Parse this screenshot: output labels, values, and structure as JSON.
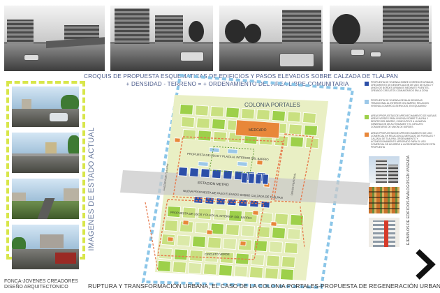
{
  "title": {
    "line1": "CROQUIS DE PROPUESTA ESQUEMATICAS DE EDIFICIOS Y PASOS ELEVADOS SOBRE CALZADA DE TLALPAN",
    "line2": "+ DENSIDAD - TERRENO = + ORDENAMIENTO DEL AREA LIBRE COMUNITARIA"
  },
  "left_panel": {
    "label": "IMAGENES DE ESTADO ACTUAL",
    "credits_line1": "FONCA-JOVENES CREADORES",
    "credits_line2": "DISEÑO ARQUITECTONICO"
  },
  "map": {
    "labels": {
      "colonia": "COLONIA PORTALES",
      "mercado": "MERCADO",
      "estacion": "ESTACION METRO",
      "propuesta_usos_top": "PROPUESTA DE USOS Y PLAZA AL INTERIOR DEL BARRIO",
      "nueva_propuesta": "NUEVA PROPUESTA DE PASO ELEVADO SOBRE CALZADA DE TLALPAN",
      "propuesta_usos_bottom": "PROPUESTA DE USOS Y PLAZA AL INTERIOR DEL BARRIO",
      "circuito": "CIRCUITO VERDE",
      "calzada": "CALZADA DE TLALPAN",
      "cruce": "CRUCE PEATONAL"
    }
  },
  "legend": [
    {
      "color": "#2c4fa8",
      "text": "PROPUESTA DE VIVIENDA SOBRE CORREDOR URBANO, CRECIMIENTO DE DENSIFICACION DE USO DE SUELO Y UNION DE BORDES URBANOS MEDIANTE PUENTES, CREANDO CIRCUITOS COMUNITARIOS EN LA ZONA"
    },
    {
      "color": "#9cc8e8",
      "text": "PROPUESTA DE VIVIENDA DE BAJA DENSIDAD TRADICIONAL AL INTERIOR DEL BARRIO, RELACION VIVIENDA COMERCIO-SERVICIOS, EN EQUILIBRIO"
    },
    {
      "color": "#9dd04a",
      "text": "AREAS PROPUESTAS DE APROVECHAMIENTO DE NUEVAS AREAS VERDES PARA VIVIENDA SOBRE TLALPAN Y DENTRO DEL BARRIO, COMO APOYO A LA NUEVA GENERACION DE ACTIVIDADES Y EL CIRCUITO COMUNITARIO DE UNION DE BORDES"
    },
    {
      "color": "#e8873a",
      "text": "AREAS PROPUESTAS DE APROVECHAMIENTO DE USO COMERCIAL EN RELACION AL MERCADO DE PORTALES Y CALZADA DE TLALPAN, ORDENAMIENTO Y ACONDICIONAMIENTO APROPIADO PARA EL USO COMERCIAL DE ACUERDO A LA REGENERACION DE ESTA PROPUESTA"
    }
  ],
  "right_panel": {
    "label": "EJEMPLOS DE EDIFICIOS ANALOGOS EN VIVIENDA"
  },
  "footer": {
    "title": "RUPTURA Y TRANSFORMACIÓN URBANA, EL CASO DE LA COLONIA PORTALES-PROPUESTA DE REGENERACIÓN URBANA"
  },
  "icons": [
    "next-arrow-icon"
  ]
}
